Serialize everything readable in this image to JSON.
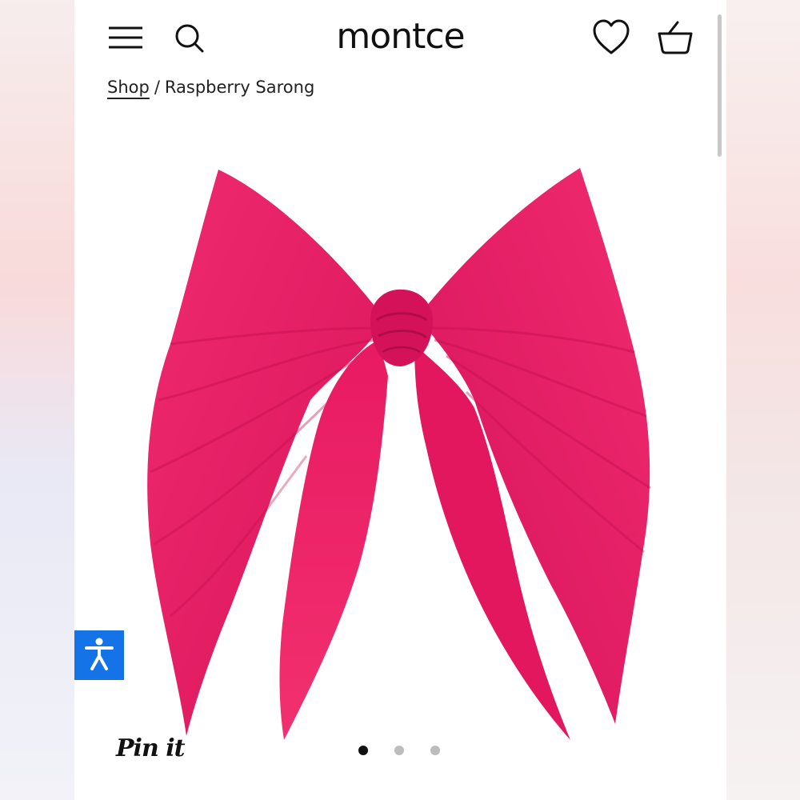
{
  "header": {
    "logo_text": "montce",
    "menu_icon": "hamburger-menu-icon",
    "search_icon": "search-icon",
    "wishlist_icon": "heart-icon",
    "cart_icon": "basket-icon"
  },
  "breadcrumb": {
    "link_label": "Shop",
    "separator": "/",
    "current_label": "Raspberry Sarong"
  },
  "product": {
    "image_name": "raspberry-sarong-image",
    "color": "#e8185f"
  },
  "gallery": {
    "total_images": 3,
    "active_index": 0
  },
  "pinterest": {
    "label": "Pin it"
  },
  "accessibility": {
    "icon": "accessibility-person-icon",
    "color": "#1473e6"
  }
}
